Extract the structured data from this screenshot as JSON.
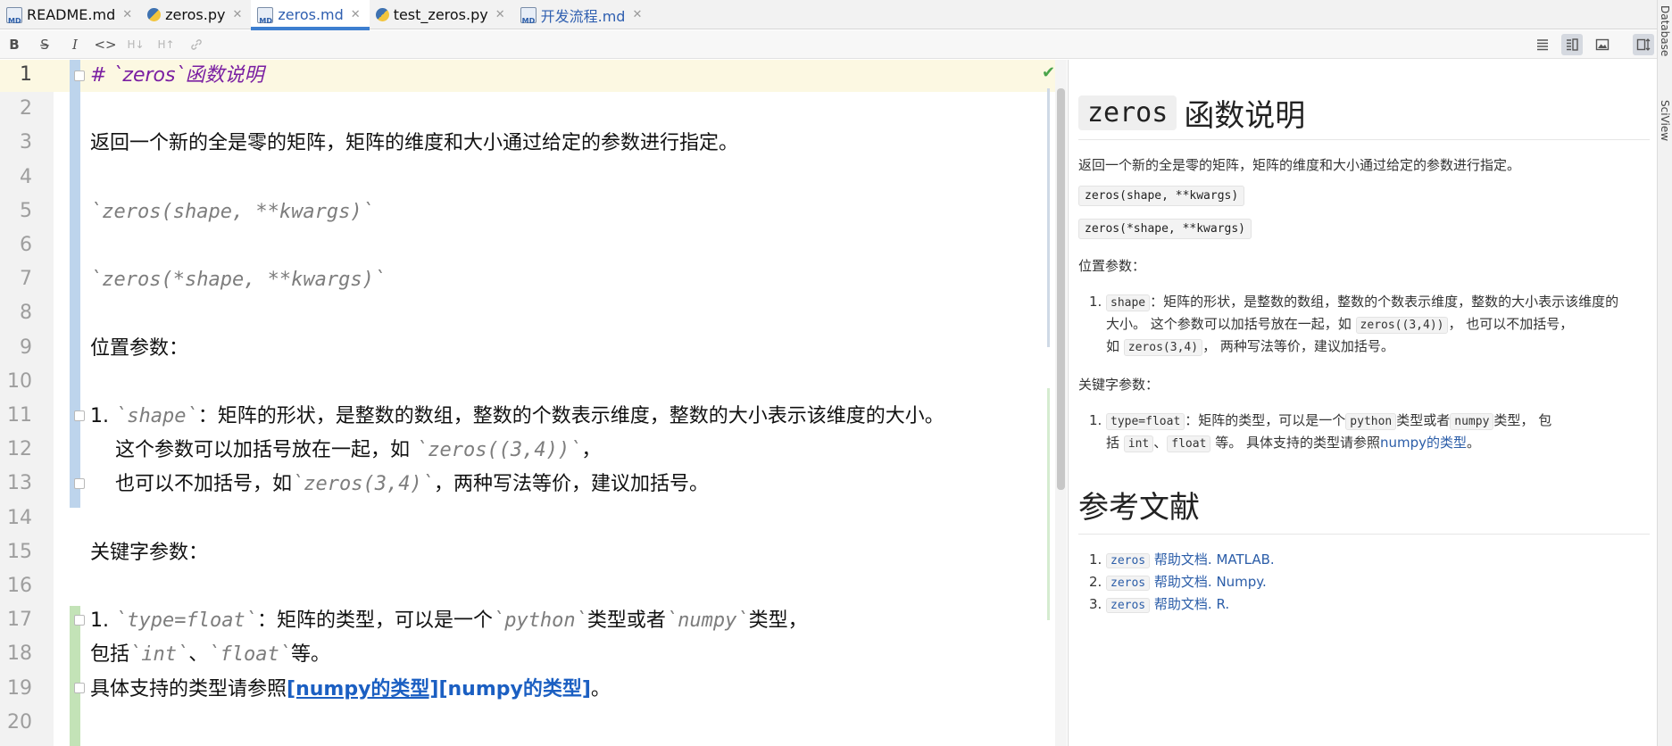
{
  "tabs": [
    {
      "label": "README.md",
      "icon": "markdown-file-icon",
      "active": false
    },
    {
      "label": "zeros.py",
      "icon": "python-file-icon",
      "active": false
    },
    {
      "label": "zeros.md",
      "icon": "markdown-file-icon",
      "active": true
    },
    {
      "label": "test_zeros.py",
      "icon": "python-file-icon",
      "active": false
    },
    {
      "label": "开发流程.md",
      "icon": "markdown-file-icon",
      "active": false
    }
  ],
  "toolbar": {
    "left": [
      {
        "name": "bold-button",
        "glyph": "B"
      },
      {
        "name": "strikethrough-button",
        "glyph": "S̶"
      },
      {
        "name": "italic-button",
        "glyph": "I"
      },
      {
        "name": "code-button",
        "glyph": "<>"
      },
      {
        "name": "header-decrease-button",
        "glyph": "H↓"
      },
      {
        "name": "header-increase-button",
        "glyph": "H↑"
      },
      {
        "name": "link-button",
        "glyph": "🔗"
      }
    ],
    "right": [
      {
        "name": "editor-only-button",
        "glyph": "☰"
      },
      {
        "name": "editor-and-preview-button",
        "glyph": "◧",
        "selected": true
      },
      {
        "name": "preview-only-button",
        "glyph": "▣"
      },
      {
        "name": "scroll-sync-button",
        "glyph": "⇕",
        "selected": true
      }
    ]
  },
  "editor": {
    "current_line": 1,
    "line_numbers": [
      "1",
      "2",
      "3",
      "4",
      "5",
      "6",
      "7",
      "8",
      "9",
      "10",
      "11",
      "12",
      "13",
      "14",
      "15",
      "16",
      "17",
      "18",
      "19",
      "20"
    ],
    "lines": [
      {
        "n": 1,
        "parts": [
          {
            "t": "# `zeros`函数说明",
            "s": "head"
          }
        ]
      },
      {
        "n": 3,
        "parts": [
          {
            "t": "返回一个新的全是零的矩阵，矩阵的维度和大小通过给定的参数进行指定。",
            "s": "text"
          }
        ]
      },
      {
        "n": 5,
        "parts": [
          {
            "t": "`zeros(shape, **kwargs)`",
            "s": "mono"
          }
        ]
      },
      {
        "n": 7,
        "parts": [
          {
            "t": "`zeros(*shape, **kwargs)`",
            "s": "mono"
          }
        ]
      },
      {
        "n": 9,
        "parts": [
          {
            "t": "位置参数：",
            "s": "text"
          }
        ]
      },
      {
        "n": 11,
        "parts": [
          {
            "t": "1. ",
            "s": "text"
          },
          {
            "t": "`shape`",
            "s": "mono"
          },
          {
            "t": "：矩阵的形状，是整数的数组，整数的个数表示维度，整数的大小表示该维度的大小。",
            "s": "text"
          }
        ]
      },
      {
        "n": 12,
        "parts": [
          {
            "t": "    这个参数可以加括号放在一起，如 ",
            "s": "text"
          },
          {
            "t": "`zeros((3,4))`",
            "s": "mono"
          },
          {
            "t": "，",
            "s": "text"
          }
        ]
      },
      {
        "n": 13,
        "parts": [
          {
            "t": "    也可以不加括号，如",
            "s": "text"
          },
          {
            "t": "`zeros(3,4)`",
            "s": "mono"
          },
          {
            "t": "，两种写法等价，建议加括号。",
            "s": "text"
          }
        ]
      },
      {
        "n": 15,
        "parts": [
          {
            "t": "关键字参数：",
            "s": "text"
          }
        ]
      },
      {
        "n": 17,
        "parts": [
          {
            "t": "1. ",
            "s": "text"
          },
          {
            "t": "`type=float`",
            "s": "mono"
          },
          {
            "t": "：矩阵的类型，可以是一个",
            "s": "text"
          },
          {
            "t": "`python`",
            "s": "mono"
          },
          {
            "t": "类型或者",
            "s": "text"
          },
          {
            "t": "`numpy`",
            "s": "mono"
          },
          {
            "t": "类型，",
            "s": "text"
          }
        ]
      },
      {
        "n": 18,
        "parts": [
          {
            "t": "包括",
            "s": "text"
          },
          {
            "t": "`int`",
            "s": "mono"
          },
          {
            "t": "、",
            "s": "text"
          },
          {
            "t": "`float`",
            "s": "mono"
          },
          {
            "t": "等。",
            "s": "text"
          }
        ]
      },
      {
        "n": 19,
        "parts": [
          {
            "t": "具体支持的类型请参照",
            "s": "text"
          },
          {
            "t": "[numpy的类型]",
            "s": "linku"
          },
          {
            "t": "[numpy的类型]",
            "s": "link"
          },
          {
            "t": "。",
            "s": "text"
          }
        ]
      }
    ]
  },
  "preview": {
    "h1_code": "zeros",
    "h1_text": "函数说明",
    "intro": "返回一个新的全是零的矩阵，矩阵的维度和大小通过给定的参数进行指定。",
    "sig1": "zeros(shape, **kwargs)",
    "sig2": "zeros(*shape, **kwargs)",
    "pos_title": "位置参数：",
    "pos_item": {
      "num": "1.",
      "code": "shape",
      "line1_rest": "：矩阵的形状，是整数的数组，整数的个数表示维度，整数的大小表示该维度的",
      "line2_a": "大小。 这个参数可以加括号放在一起，如 ",
      "line2_code": "zeros((3,4))",
      "line2_b": "， 也可以不加括号，",
      "line3_a": "如 ",
      "line3_code": "zeros(3,4)",
      "line3_b": "， 两种写法等价，建议加括号。"
    },
    "kw_title": "关键字参数：",
    "kw_item": {
      "num": "1.",
      "code": "type=float",
      "line1_a": "：矩阵的类型，可以是一个",
      "line1_code2": "python",
      "line1_b": "类型或者",
      "line1_code3": "numpy",
      "line1_c": "类型， 包",
      "line2_a": "括 ",
      "line2_code1": "int",
      "line2_sep": "、",
      "line2_code2": "float",
      "line2_b": " 等。 具体支持的类型请参照",
      "line2_link": "numpy的类型",
      "line2_end": "。"
    },
    "refs_title": "参考文献",
    "refs": [
      {
        "num": "1.",
        "code": "zeros",
        "text": " 帮助文档. MATLAB."
      },
      {
        "num": "2.",
        "code": "zeros",
        "text": " 帮助文档. Numpy."
      },
      {
        "num": "3.",
        "code": "zeros",
        "text": " 帮助文档. R."
      }
    ]
  },
  "right_strip": {
    "labels": [
      "Database",
      "SciView"
    ]
  },
  "colors": {
    "accent": "#3d7fd0",
    "link": "#1b5fc2",
    "heading": "#7a1fa2",
    "check": "#4aa44a"
  }
}
